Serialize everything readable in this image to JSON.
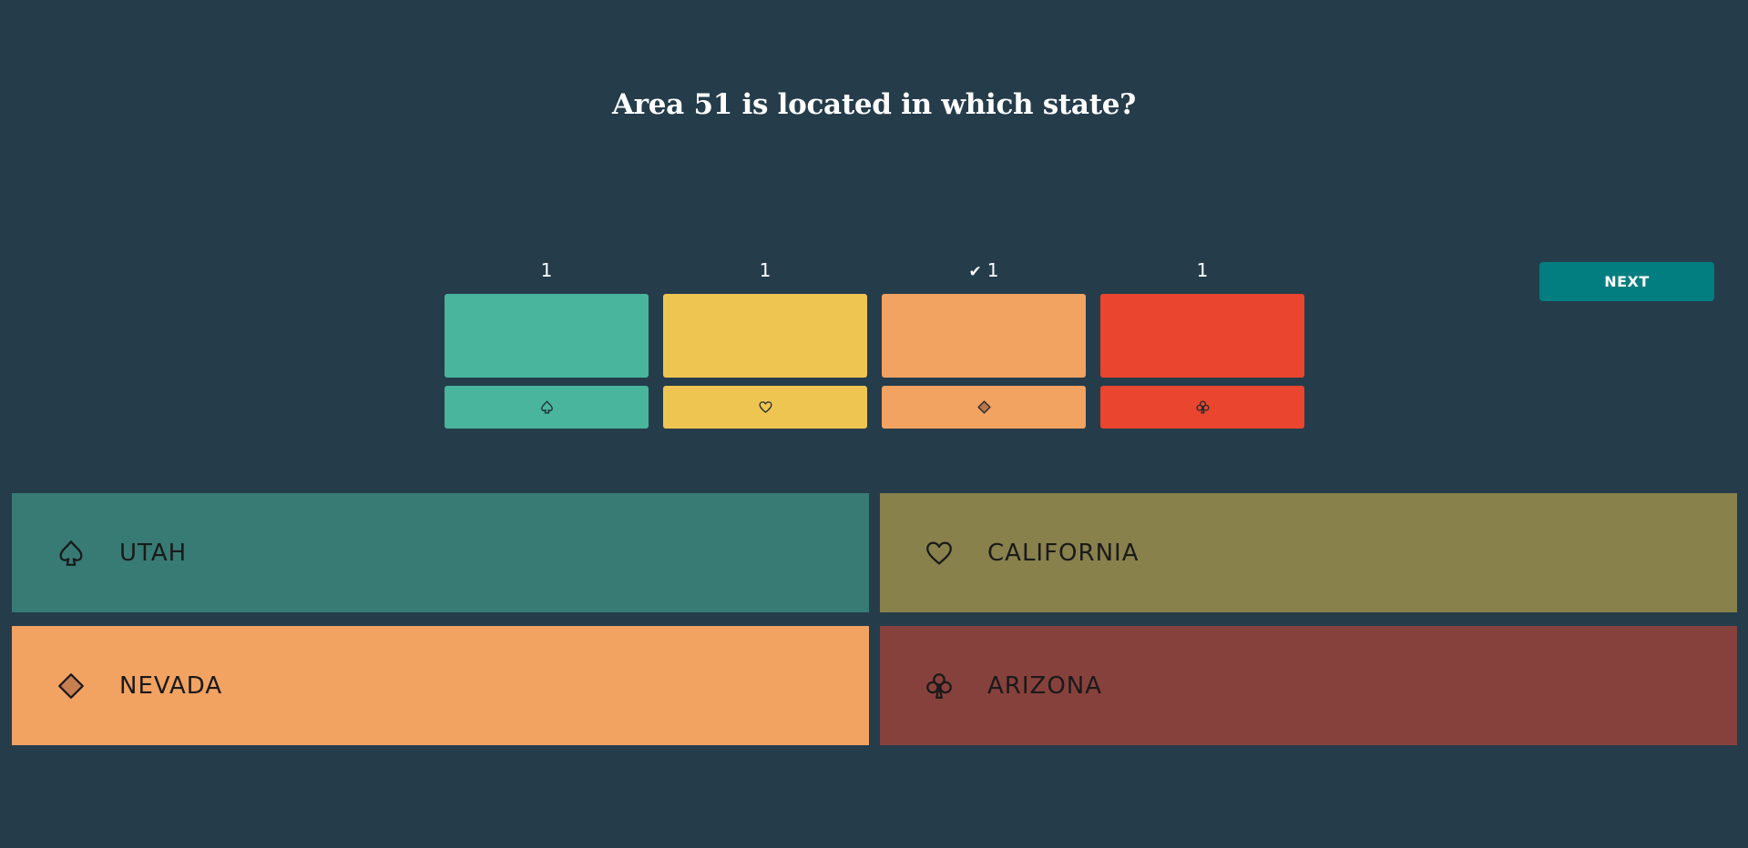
{
  "question": "Area 51 is located in which state?",
  "next_label": "NEXT",
  "colors": {
    "background": "#253c4b",
    "next_button": "#027d80"
  },
  "chart_data": {
    "type": "bar",
    "categories": [
      "spade",
      "heart",
      "diamond",
      "club"
    ],
    "values": [
      1,
      1,
      1,
      1
    ],
    "correct_index": 2,
    "bar_colors": [
      "#48b59c",
      "#efc551",
      "#f2a261",
      "#ea452e"
    ]
  },
  "answers": [
    {
      "label": "UTAH",
      "icon": "spade-icon",
      "color": "#377b74",
      "state": "dimmed"
    },
    {
      "label": "CALIFORNIA",
      "icon": "heart-icon",
      "color": "#88814c",
      "state": "dimmed"
    },
    {
      "label": "NEVADA",
      "icon": "diamond-icon",
      "color": "#f2a261",
      "state": "correct"
    },
    {
      "label": "ARIZONA",
      "icon": "club-icon",
      "color": "#87413c",
      "state": "dimmed"
    }
  ]
}
